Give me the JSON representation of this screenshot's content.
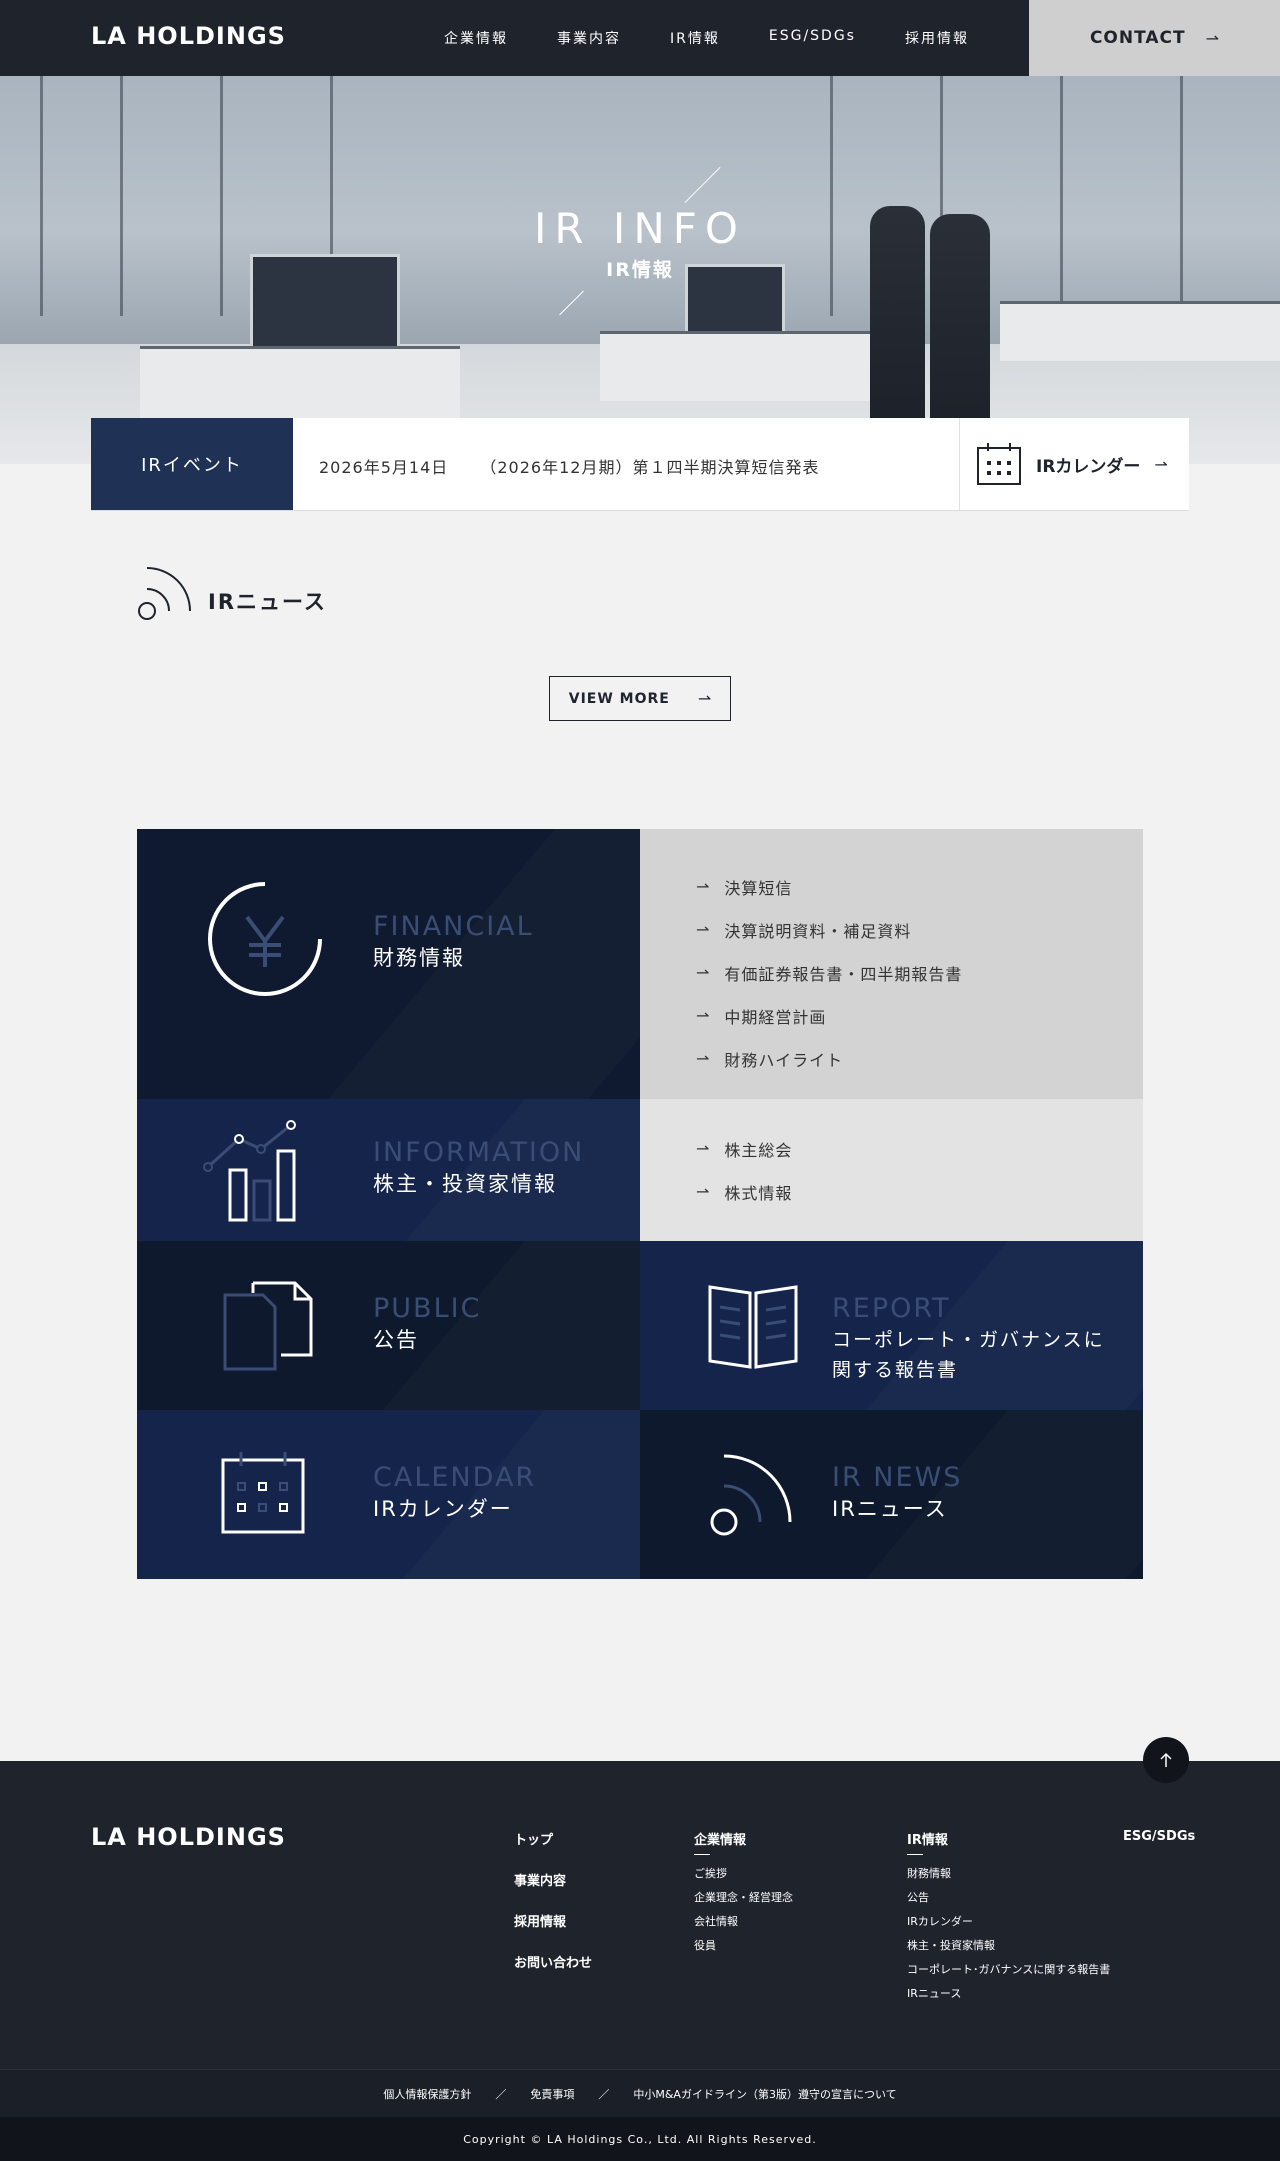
{
  "header": {
    "logo": "LA HOLDINGS",
    "nav": [
      "企業情報",
      "事業内容",
      "IR情報",
      "ESG/SDGs",
      "採用情報"
    ],
    "contact": "CONTACT"
  },
  "hero": {
    "title_en": "IR INFO",
    "title_ja": "IR情報"
  },
  "event": {
    "tag": "IRイベント",
    "date": "2026年5月14日",
    "text": "（2026年12月期）第１四半期決算短信発表",
    "calendar_label": "IRカレンダー"
  },
  "news": {
    "title": "IRニュース",
    "view_more": "VIEW MORE"
  },
  "grid": {
    "financial": {
      "en": "FINANCIAL",
      "ja": "財務情報",
      "links": [
        "決算短信",
        "決算説明資料・補足資料",
        "有価証券報告書・四半期報告書",
        "中期経営計画",
        "財務ハイライト"
      ]
    },
    "information": {
      "en": "INFORMATION",
      "ja": "株主・投資家情報",
      "links": [
        "株主総会",
        "株式情報"
      ]
    },
    "public": {
      "en": "PUBLIC",
      "ja": "公告"
    },
    "report": {
      "en": "REPORT",
      "ja_line1": "コーポレート・ガバナンスに",
      "ja_line2": "関する報告書"
    },
    "calendar": {
      "en": "CALENDAR",
      "ja": "IRカレンダー"
    },
    "irnews": {
      "en": "IR NEWS",
      "ja": "IRニュース"
    }
  },
  "footer": {
    "logo": "LA HOLDINGS",
    "col1": [
      "トップ",
      "事業内容",
      "採用情報",
      "お問い合わせ"
    ],
    "col2": {
      "title": "企業情報",
      "items": [
        "ご挨拶",
        "企業理念・経営理念",
        "会社情報",
        "役員"
      ]
    },
    "col3": {
      "title": "IR情報",
      "items": [
        "財務情報",
        "公告",
        "IRカレンダー",
        "株主・投資家情報",
        "コーポレート･ガバナンスに関する報告書",
        "IRニュース"
      ]
    },
    "col4": "ESG/SDGs",
    "bottom_links": [
      "個人情報保護方針",
      "／",
      "免責事項",
      "／",
      "中小M&Aガイドライン（第3版）遵守の宣言について"
    ],
    "copyright": "Copyright © LA Holdings Co., Ltd. All Rights Reserved."
  }
}
